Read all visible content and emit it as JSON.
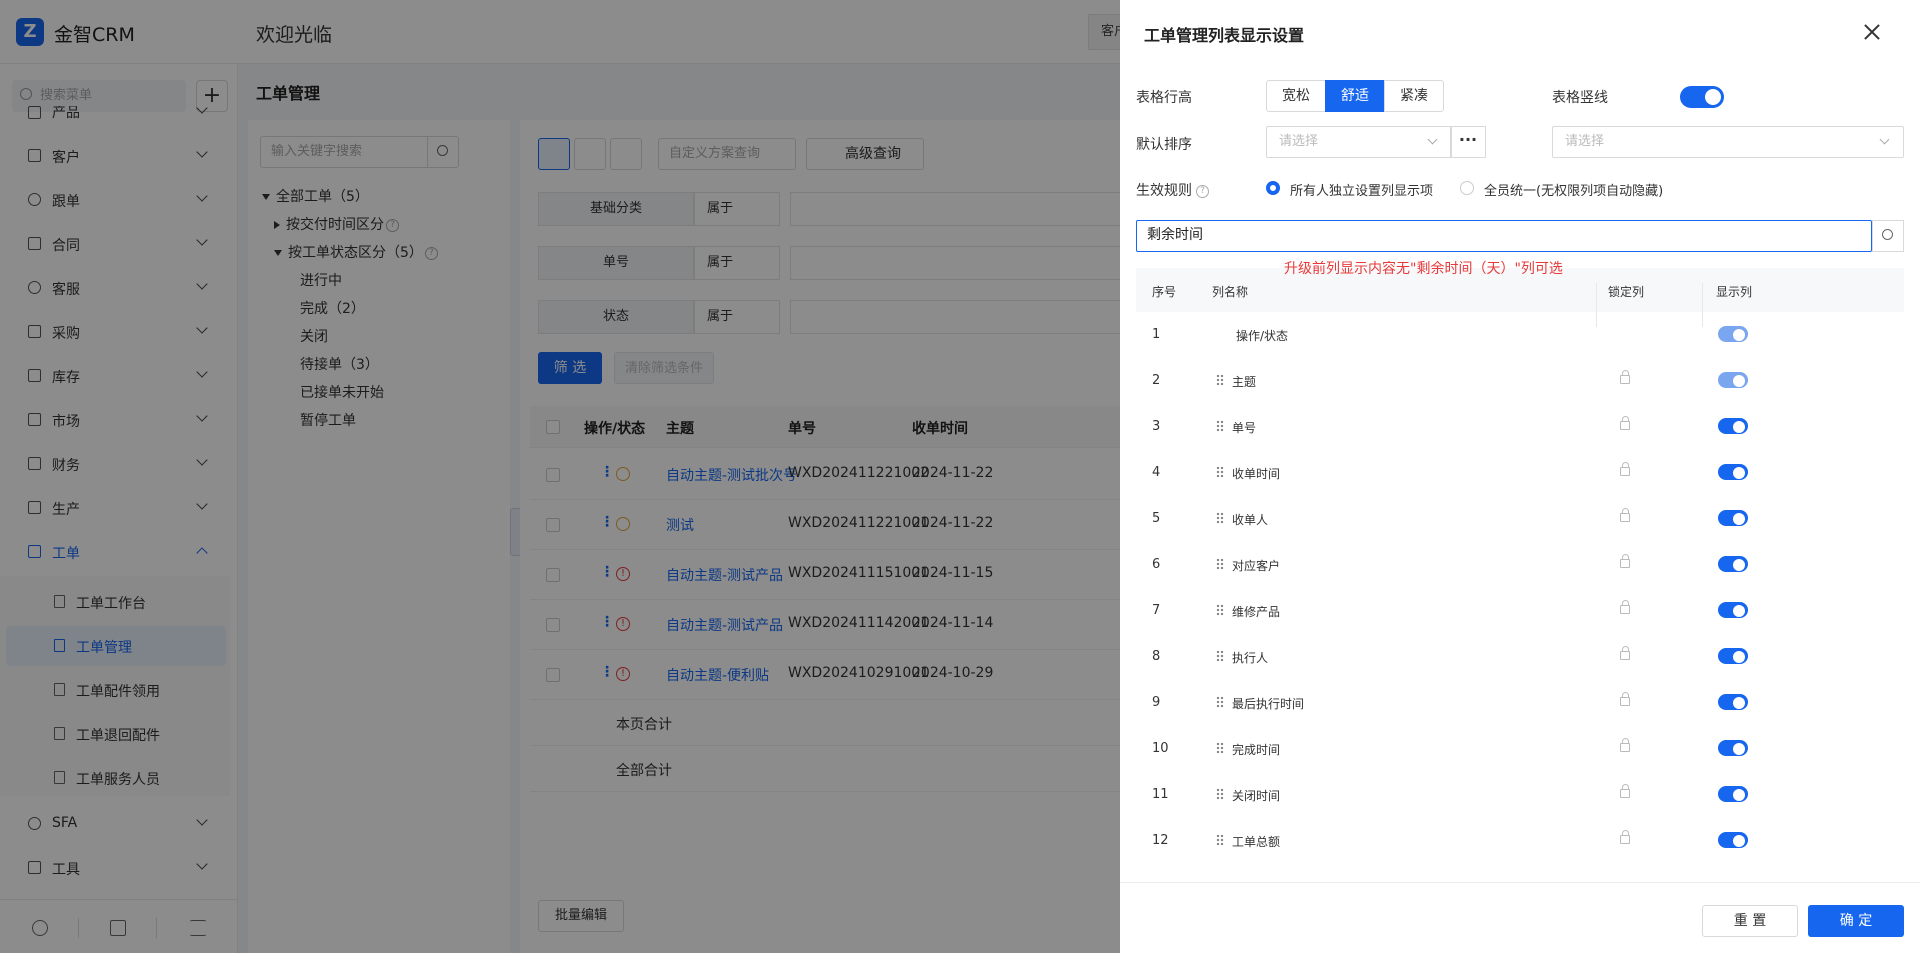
{
  "app": {
    "logo_letter": "Z",
    "name": "金智CRM",
    "welcome": "欢迎光临",
    "top_tab": "客户"
  },
  "sidebar": {
    "search_placeholder": "搜索菜单",
    "add_label": "+",
    "items": [
      {
        "label": "产品",
        "icon": "box-icon"
      },
      {
        "label": "客户",
        "icon": "chart-icon"
      },
      {
        "label": "跟单",
        "icon": "target-icon"
      },
      {
        "label": "合同",
        "icon": "doc-icon"
      },
      {
        "label": "客服",
        "icon": "headset-icon"
      },
      {
        "label": "采购",
        "icon": "bag-icon"
      },
      {
        "label": "库存",
        "icon": "warehouse-icon"
      },
      {
        "label": "市场",
        "icon": "flag-icon"
      },
      {
        "label": "财务",
        "icon": "bank-icon"
      },
      {
        "label": "生产",
        "icon": "factory-icon"
      },
      {
        "label": "工单",
        "icon": "ticket-icon"
      }
    ],
    "sub_items": [
      {
        "label": "工单工作台",
        "icon": "dashboard-icon"
      },
      {
        "label": "工单管理",
        "icon": "file-icon"
      },
      {
        "label": "工单配件领用",
        "icon": "file-icon"
      },
      {
        "label": "工单退回配件",
        "icon": "file-icon"
      },
      {
        "label": "工单服务人员",
        "icon": "person-icon"
      }
    ],
    "bottom_items": [
      {
        "label": "SFA",
        "icon": "sfa-icon"
      },
      {
        "label": "工具",
        "icon": "toolbox-icon"
      }
    ]
  },
  "page": {
    "title": "工单管理"
  },
  "tree": {
    "search_placeholder": "输入关键字搜索",
    "root": "全部工单（5）",
    "group1": "按交付时间区分",
    "group2": "按工单状态区分（5）",
    "leaves": [
      "进行中",
      "完成（2）",
      "关闭",
      "待接单（3）",
      "已接单未开始",
      "暂停工单"
    ],
    "help": "?"
  },
  "toolbar": {
    "scheme_placeholder": "自定义方案查询",
    "advanced": "高级查询"
  },
  "filters": [
    {
      "label": "基础分类",
      "op": "属于"
    },
    {
      "label": "单号",
      "op": "属于"
    },
    {
      "label": "状态",
      "op": "属于"
    }
  ],
  "filter_btn": "筛 选",
  "clear_btn": "清除筛选条件",
  "table": {
    "headers": [
      "操作/状态",
      "主题",
      "单号",
      "收单时间"
    ],
    "rows": [
      {
        "subject": "自动主题-测试批次号",
        "no": "WXD202411221002",
        "date": "2024-11-22",
        "status": "play"
      },
      {
        "subject": "测试",
        "no": "WXD202411221001",
        "date": "2024-11-22",
        "status": "play"
      },
      {
        "subject": "自动主题-测试产品",
        "no": "WXD202411151001",
        "date": "2024-11-15",
        "status": "error"
      },
      {
        "subject": "自动主题-测试产品",
        "no": "WXD202411142001",
        "date": "2024-11-14",
        "status": "error"
      },
      {
        "subject": "自动主题-便利贴",
        "no": "WXD202410291001",
        "date": "2024-10-29",
        "status": "error"
      }
    ],
    "page_total": "本页合计",
    "all_total": "全部合计",
    "more": "⋮",
    "err_mark": "!"
  },
  "batch_edit": "批量编辑",
  "drawer": {
    "title": "工单管理列表显示设置",
    "row_height_label": "表格行高",
    "row_heights": [
      "宽松",
      "舒适",
      "紧凑"
    ],
    "vertical_line_label": "表格竖线",
    "default_sort_label": "默认排序",
    "sort_placeholder": "请选择",
    "sort_placeholder2": "请选择",
    "dots": "···",
    "rule_label": "生效规则",
    "rule_help": "?",
    "rule_options": [
      "所有人独立设置列显示项",
      "全员统一(无权限列项自动隐藏)"
    ],
    "search_value": "剩余时间",
    "annotation": "升级前列显示内容无\"剩余时间（天）\"列可选",
    "col_headers": [
      "序号",
      "列名称",
      "锁定列",
      "显示列"
    ],
    "columns": [
      {
        "seq": "1",
        "name": "操作/状态",
        "fixed": true
      },
      {
        "seq": "2",
        "name": "主题",
        "dim": true
      },
      {
        "seq": "3",
        "name": "单号"
      },
      {
        "seq": "4",
        "name": "收单时间"
      },
      {
        "seq": "5",
        "name": "收单人"
      },
      {
        "seq": "6",
        "name": "对应客户"
      },
      {
        "seq": "7",
        "name": "维修产品"
      },
      {
        "seq": "8",
        "name": "执行人"
      },
      {
        "seq": "9",
        "name": "最后执行时间"
      },
      {
        "seq": "10",
        "name": "完成时间"
      },
      {
        "seq": "11",
        "name": "关闭时间"
      },
      {
        "seq": "12",
        "name": "工单总额"
      }
    ],
    "reset": "重 置",
    "confirm": "确 定"
  },
  "colors": {
    "accent": "#1666f0",
    "error": "#e63a3a",
    "warning": "#e6a23c"
  }
}
